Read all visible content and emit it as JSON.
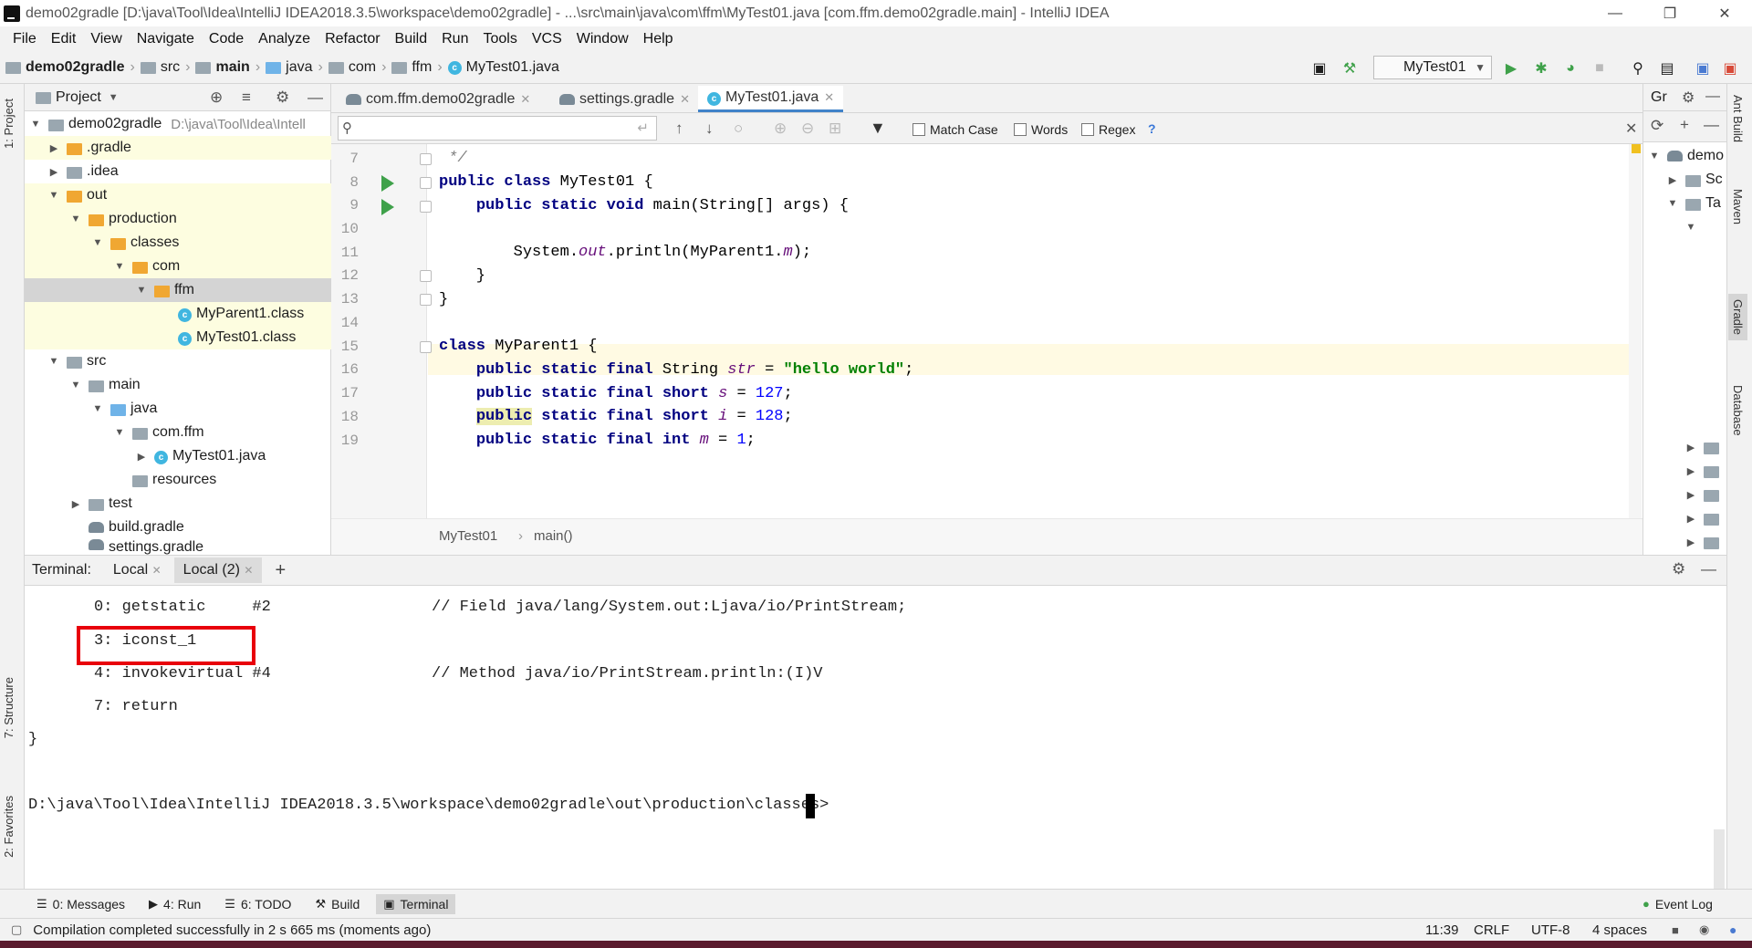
{
  "window": {
    "title": "demo02gradle [D:\\java\\Tool\\Idea\\IntelliJ IDEA2018.3.5\\workspace\\demo02gradle] - ...\\src\\main\\java\\com\\ffm\\MyTest01.java [com.ffm.demo02gradle.main] - IntelliJ IDEA"
  },
  "menu": [
    "File",
    "Edit",
    "View",
    "Navigate",
    "Code",
    "Analyze",
    "Refactor",
    "Build",
    "Run",
    "Tools",
    "VCS",
    "Window",
    "Help"
  ],
  "breadcrumbs": [
    "demo02gradle",
    "src",
    "main",
    "java",
    "com",
    "ffm",
    "MyTest01.java"
  ],
  "run_config": "MyTest01",
  "project": {
    "header": "Project",
    "root_name": "demo02gradle",
    "root_path": "D:\\java\\Tool\\Idea\\Intell",
    "items": [
      ".gradle",
      ".idea",
      "out",
      "production",
      "classes",
      "com",
      "ffm",
      "MyParent1.class",
      "MyTest01.class",
      "src",
      "main",
      "java",
      "com.ffm",
      "MyTest01.java",
      "resources",
      "test",
      "build.gradle",
      "settings.gradle"
    ]
  },
  "editor": {
    "tabs": [
      "com.ffm.demo02gradle",
      "settings.gradle",
      "MyTest01.java"
    ],
    "find": {
      "match_case": "Match Case",
      "words": "Words",
      "regex": "Regex",
      "help": "?"
    },
    "line_numbers": [
      "7",
      "8",
      "9",
      "10",
      "11",
      "12",
      "13",
      "14",
      "15",
      "16",
      "17",
      "18",
      "19"
    ],
    "breadcrumb": [
      "MyTest01",
      "main()"
    ]
  },
  "gradle_panel": {
    "title": "Gr",
    "root": "demo",
    "child1": "Sc",
    "child2": "Ta"
  },
  "right_tabs": [
    "Ant Build",
    "Maven",
    "Gradle",
    "Database"
  ],
  "left_tabs": [
    "1: Project",
    "7: Structure",
    "2: Favorites"
  ],
  "terminal": {
    "label": "Terminal:",
    "tabs": [
      "Local",
      "Local (2)"
    ],
    "lines": [
      {
        "instr": "0: getstatic     #2",
        "comment": "// Field java/lang/System.out:Ljava/io/PrintStream;"
      },
      {
        "instr": "3: iconst_1",
        "comment": ""
      },
      {
        "instr": "4: invokevirtual #4",
        "comment": "// Method java/io/PrintStream.println:(I)V"
      },
      {
        "instr": "7: return",
        "comment": ""
      }
    ],
    "closing_brace": "}",
    "prompt": "D:\\java\\Tool\\Idea\\IntelliJ IDEA2018.3.5\\workspace\\demo02gradle\\out\\production\\classes>"
  },
  "bottom_tabs": [
    "0: Messages",
    "4: Run",
    "6: TODO",
    "Build",
    "Terminal"
  ],
  "event_log": "Event Log",
  "status": {
    "message": "Compilation completed successfully in 2 s 665 ms (moments ago)",
    "position": "11:39",
    "line_sep": "CRLF",
    "encoding": "UTF-8",
    "indent": "4 spaces"
  },
  "colors": {
    "highlight_red": "#e8000b",
    "run_green": "#3fa14a",
    "keyword": "#000080",
    "string": "#008000"
  }
}
